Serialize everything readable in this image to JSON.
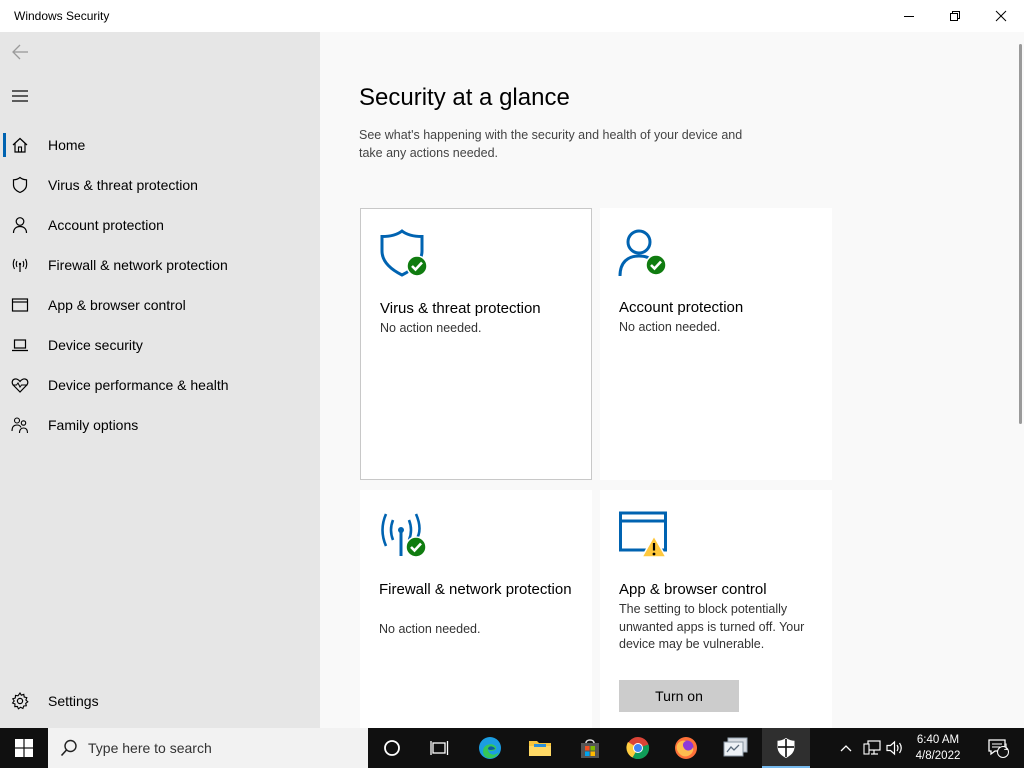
{
  "window": {
    "title": "Windows Security"
  },
  "sidebar": {
    "items": [
      {
        "label": "Home",
        "icon": "home-icon",
        "active": true
      },
      {
        "label": "Virus & threat protection",
        "icon": "shield-icon"
      },
      {
        "label": "Account protection",
        "icon": "person-icon"
      },
      {
        "label": "Firewall & network protection",
        "icon": "antenna-icon"
      },
      {
        "label": "App & browser control",
        "icon": "browser-window-icon"
      },
      {
        "label": "Device security",
        "icon": "laptop-icon"
      },
      {
        "label": "Device performance & health",
        "icon": "heart-icon"
      },
      {
        "label": "Family options",
        "icon": "family-icon"
      }
    ],
    "settings_label": "Settings"
  },
  "main": {
    "title": "Security at a glance",
    "subtitle": "See what's happening with the security and health of your device and take any actions needed.",
    "cards": [
      {
        "title": "Virus & threat protection",
        "status": "No action needed.",
        "icon": "shield-check-icon"
      },
      {
        "title": "Account protection",
        "status": "No action needed.",
        "icon": "account-check-icon"
      },
      {
        "title": "Firewall & network protection",
        "status": "No action needed.",
        "icon": "firewall-check-icon"
      },
      {
        "title": "App & browser control",
        "status": "The setting to block potentially unwanted apps is turned off. Your device may be vulnerable.",
        "icon": "app-browser-warning-icon",
        "button": "Turn on"
      }
    ]
  },
  "taskbar": {
    "search_placeholder": "Type here to search",
    "time": "6:40 AM",
    "date": "4/8/2022",
    "notification_count": "1"
  },
  "colors": {
    "accent": "#0063b1",
    "ok": "#107c10",
    "warn": "#ffc83d"
  }
}
